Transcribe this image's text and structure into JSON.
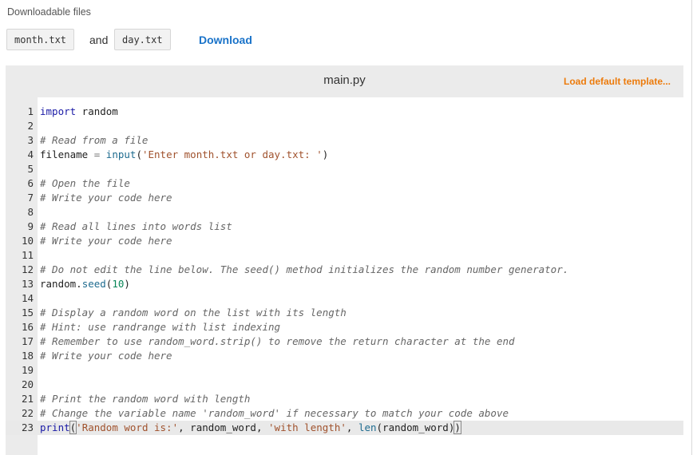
{
  "downloads": {
    "title": "Downloadable files",
    "files": [
      "month.txt",
      "day.txt"
    ],
    "joiner": "and",
    "download_label": "Download"
  },
  "editor": {
    "filename": "main.py",
    "load_template_label": "Load default template...",
    "line_numbers": [
      "1",
      "2",
      "3",
      "4",
      "5",
      "6",
      "7",
      "8",
      "9",
      "10",
      "11",
      "12",
      "13",
      "14",
      "15",
      "16",
      "17",
      "18",
      "19",
      "20",
      "21",
      "22",
      "23"
    ],
    "code": {
      "l1_kw": "import",
      "l1_rest": " random",
      "l3": "# Read from a file",
      "l4_var": "filename",
      "l4_eq": " = ",
      "l4_fn": "input",
      "l4_str": "'Enter month.txt or day.txt: '",
      "l6": "# Open the file",
      "l7": "# Write your code here",
      "l9": "# Read all lines into words list",
      "l10": "# Write your code here",
      "l12": "# Do not edit the line below. The seed() method initializes the random number generator.",
      "l13_obj": "random",
      "l13_fn": "seed",
      "l13_num": "10",
      "l15": "# Display a random word on the list with its length",
      "l16": "# Hint: use randrange with list indexing",
      "l17": "# Remember to use random_word.strip() to remove the return character at the end",
      "l18": "# Write your code here",
      "l21": "# Print the random word with length",
      "l22": "# Change the variable name 'random_word' if necessary to match your code above",
      "l23_fn": "print",
      "l23_str1": "'Random word is:'",
      "l23_var1": "random_word",
      "l23_str2": "'with length'",
      "l23_fn2": "len",
      "l23_var2": "random_word"
    }
  }
}
